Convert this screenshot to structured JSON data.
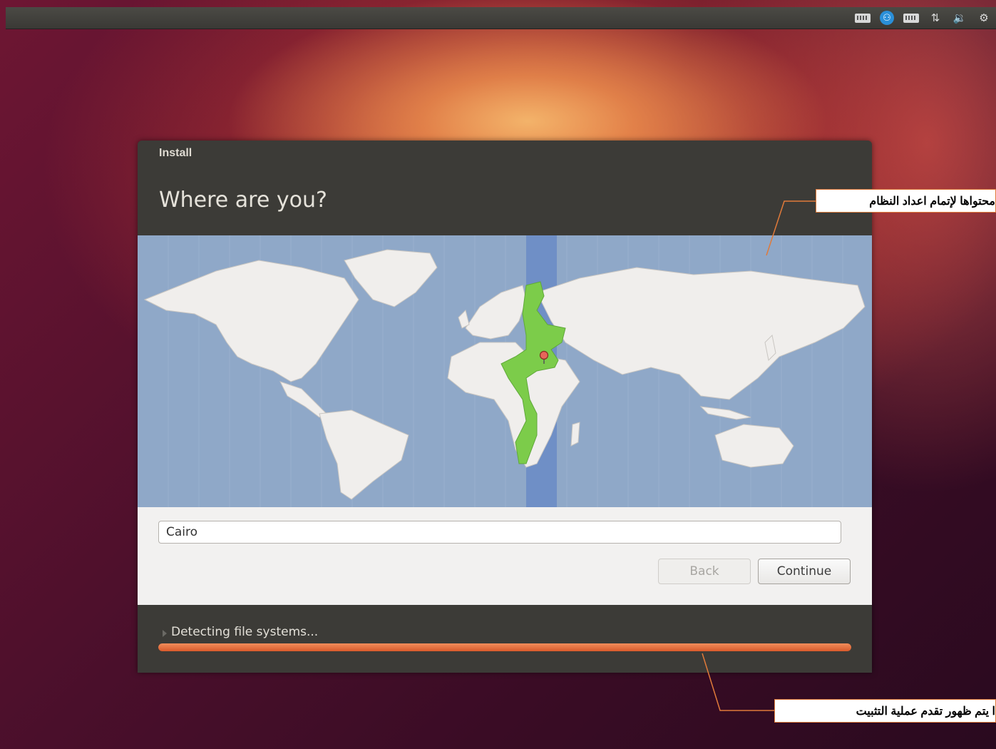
{
  "window": {
    "title": "Install",
    "heading": "Where are you?"
  },
  "location": {
    "city_value": "Cairo",
    "selected_marker": "location-pin-icon"
  },
  "buttons": {
    "back_label": "Back",
    "continue_label": "Continue"
  },
  "status": {
    "text": "Detecting file systems...",
    "progress": 1.0
  },
  "annotations": {
    "top_callout": "محتواها لإتمام اعداد النظام",
    "bottom_callout": "ا يتم ظهور تقدم عملية التثبيت"
  },
  "tray_icons": [
    "keyboard-icon",
    "accessibility-icon",
    "keyboard-icon",
    "network-icon",
    "volume-icon",
    "settings-gear-icon"
  ],
  "colors": {
    "accent_orange": "#e06430",
    "timezone_highlight": "#7ccc4a",
    "ocean": "#8fa8c8",
    "land": "#f0eeec"
  }
}
